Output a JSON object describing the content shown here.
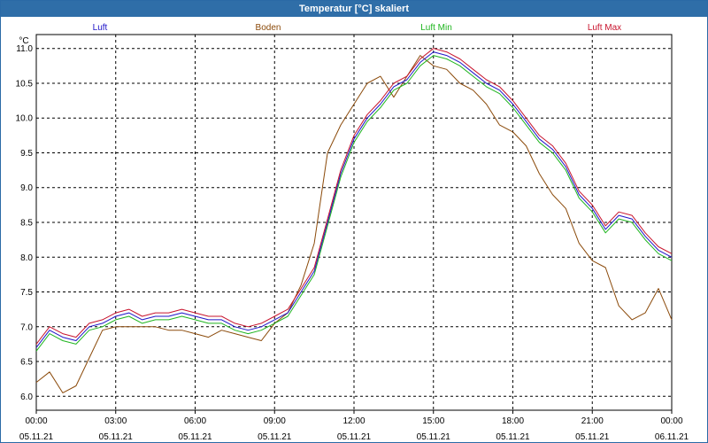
{
  "window": {
    "title": "Temperatur [°C] skaliert"
  },
  "colors": {
    "titlebar": "#2f6ea8",
    "grid": "#000000",
    "Luft": "#1e14c8",
    "Boden": "#8b4a0a",
    "Luft Min": "#1fb51f",
    "Luft Max": "#c8142d"
  },
  "chart_data": {
    "type": "line",
    "title": "Temperatur [°C] skaliert",
    "ylabel": "°C",
    "xlabel": "",
    "grid": true,
    "legend_placement": "top",
    "xlim": [
      "05.11.21 00:00",
      "06.11.21 00:00"
    ],
    "ylim": [
      5.8,
      11.2
    ],
    "yticks": [
      "6.0",
      "6.5",
      "7.0",
      "7.5",
      "8.0",
      "8.5",
      "9.0",
      "9.5",
      "10.0",
      "10.5",
      "11.0"
    ],
    "xticks": [
      {
        "time": "00:00",
        "date": "05.11.21"
      },
      {
        "time": "03:00",
        "date": "05.11.21"
      },
      {
        "time": "06:00",
        "date": "05.11.21"
      },
      {
        "time": "09:00",
        "date": "05.11.21"
      },
      {
        "time": "12:00",
        "date": "05.11.21"
      },
      {
        "time": "15:00",
        "date": "05.11.21"
      },
      {
        "time": "18:00",
        "date": "05.11.21"
      },
      {
        "time": "21:00",
        "date": "05.11.21"
      },
      {
        "time": "00:00",
        "date": "06.11.21"
      }
    ],
    "x": [
      "00:00",
      "00:30",
      "01:00",
      "01:30",
      "02:00",
      "02:30",
      "03:00",
      "03:30",
      "04:00",
      "04:30",
      "05:00",
      "05:30",
      "06:00",
      "06:30",
      "07:00",
      "07:30",
      "08:00",
      "08:30",
      "09:00",
      "09:30",
      "10:00",
      "10:30",
      "11:00",
      "11:30",
      "12:00",
      "12:30",
      "13:00",
      "13:30",
      "14:00",
      "14:30",
      "15:00",
      "15:30",
      "16:00",
      "16:30",
      "17:00",
      "17:30",
      "18:00",
      "18:30",
      "19:00",
      "19:30",
      "20:00",
      "20:30",
      "21:00",
      "21:30",
      "22:00",
      "22:30",
      "23:00",
      "23:30",
      "24:00"
    ],
    "series": [
      {
        "name": "Luft",
        "values": [
          6.7,
          6.95,
          6.85,
          6.8,
          7.0,
          7.05,
          7.15,
          7.2,
          7.1,
          7.15,
          7.15,
          7.2,
          7.15,
          7.1,
          7.1,
          7.0,
          6.95,
          7.0,
          7.1,
          7.2,
          7.5,
          7.8,
          8.5,
          9.2,
          9.7,
          10.0,
          10.2,
          10.45,
          10.55,
          10.8,
          10.95,
          10.9,
          10.8,
          10.65,
          10.5,
          10.4,
          10.2,
          9.95,
          9.7,
          9.55,
          9.3,
          8.9,
          8.7,
          8.4,
          8.6,
          8.55,
          8.3,
          8.1,
          8.0
        ]
      },
      {
        "name": "Boden",
        "values": [
          6.2,
          6.35,
          6.05,
          6.15,
          6.55,
          6.95,
          7.0,
          7.0,
          7.0,
          7.0,
          6.95,
          6.95,
          6.9,
          6.85,
          6.95,
          6.9,
          6.85,
          6.8,
          7.05,
          7.2,
          7.6,
          8.2,
          9.5,
          9.9,
          10.2,
          10.5,
          10.6,
          10.3,
          10.6,
          10.9,
          10.75,
          10.7,
          10.5,
          10.4,
          10.2,
          9.9,
          9.8,
          9.6,
          9.2,
          8.9,
          8.7,
          8.2,
          7.95,
          7.85,
          7.3,
          7.1,
          7.2,
          7.55,
          7.1
        ]
      },
      {
        "name": "Luft Min",
        "values": [
          6.65,
          6.9,
          6.8,
          6.75,
          6.95,
          7.0,
          7.1,
          7.15,
          7.05,
          7.1,
          7.1,
          7.15,
          7.1,
          7.05,
          7.05,
          6.95,
          6.9,
          6.95,
          7.05,
          7.15,
          7.45,
          7.75,
          8.45,
          9.15,
          9.65,
          9.95,
          10.15,
          10.4,
          10.5,
          10.75,
          10.9,
          10.85,
          10.75,
          10.6,
          10.45,
          10.35,
          10.15,
          9.9,
          9.65,
          9.5,
          9.25,
          8.85,
          8.65,
          8.35,
          8.55,
          8.5,
          8.25,
          8.05,
          7.95
        ]
      },
      {
        "name": "Luft Max",
        "values": [
          6.75,
          7.0,
          6.9,
          6.85,
          7.05,
          7.1,
          7.2,
          7.25,
          7.15,
          7.2,
          7.2,
          7.25,
          7.2,
          7.15,
          7.15,
          7.05,
          7.0,
          7.05,
          7.15,
          7.25,
          7.55,
          7.85,
          8.55,
          9.25,
          9.75,
          10.05,
          10.25,
          10.5,
          10.6,
          10.85,
          11.0,
          10.95,
          10.85,
          10.7,
          10.55,
          10.45,
          10.25,
          10.0,
          9.75,
          9.6,
          9.35,
          8.95,
          8.75,
          8.45,
          8.65,
          8.6,
          8.35,
          8.15,
          8.05
        ]
      }
    ]
  }
}
